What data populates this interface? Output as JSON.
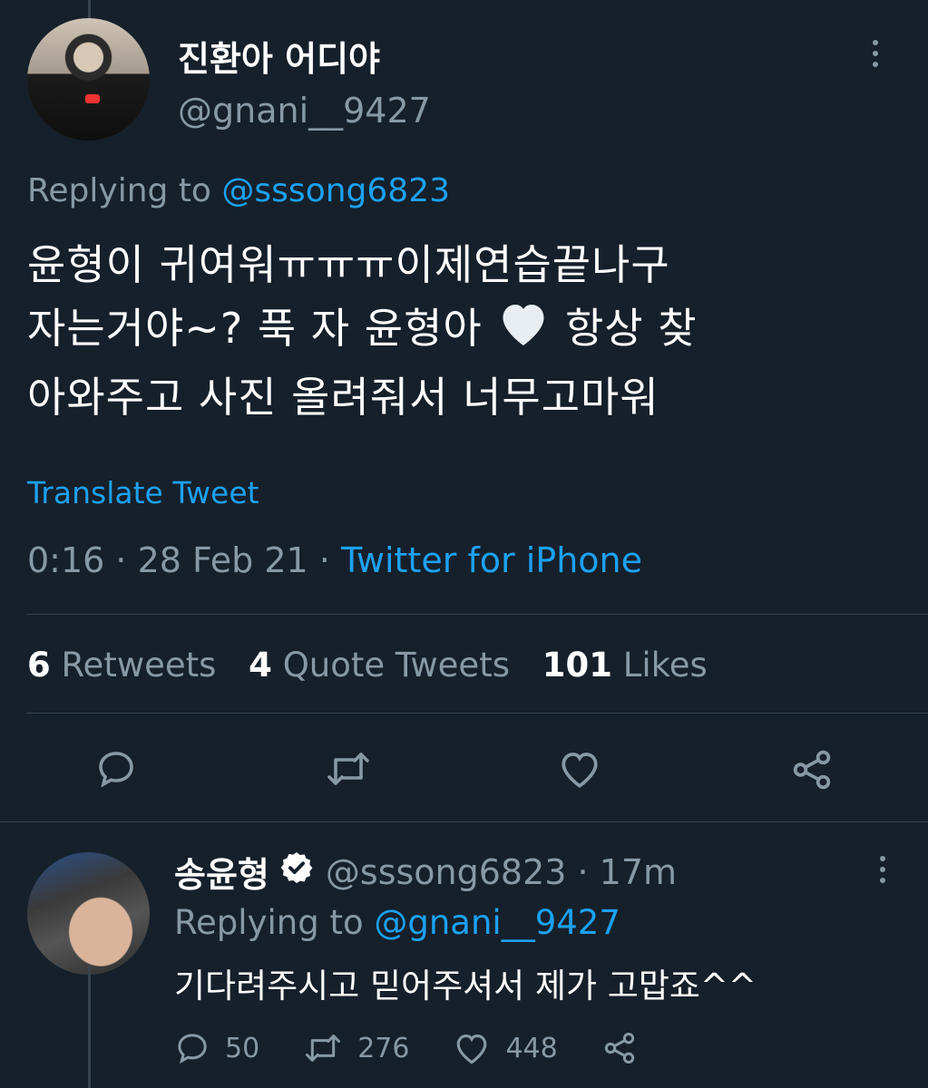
{
  "tweet": {
    "author_name": "진환아 어디야",
    "author_handle": "@gnani__9427",
    "replying_prefix": "Replying to",
    "replying_handle": "@sssong6823",
    "text_line1": "윤형이 귀여워ㅠㅠㅠ이제연습끝나구",
    "text_line2a": "자는거야~? 푹 자 윤형아",
    "text_line2b": "항상 찾",
    "text_line3": "아와주고 사진 올려줘서 너무고마워",
    "translate_label": "Translate Tweet",
    "timestamp": "0:16 · 28 Feb 21 ·",
    "source": "Twitter for iPhone"
  },
  "stats": {
    "retweets_count": "6",
    "retweets_label": "Retweets",
    "quotes_count": "4",
    "quotes_label": "Quote Tweets",
    "likes_count": "101",
    "likes_label": "Likes"
  },
  "actions": [
    "reply-icon",
    "retweet-icon",
    "like-icon",
    "share-icon"
  ],
  "reply": {
    "author_name": "송윤형",
    "author_handle_time": "@sssong6823 · 17m",
    "replying_prefix": "Replying to",
    "replying_handle": "@gnani__9427",
    "text": "기다려주시고 믿어주셔서 제가 고맙죠^^",
    "reply_count": "50",
    "retweet_count": "276",
    "like_count": "448"
  },
  "colors": {
    "background": "#15202b",
    "accent": "#1da1f2",
    "muted": "#8899a6",
    "divider": "#38444d"
  }
}
